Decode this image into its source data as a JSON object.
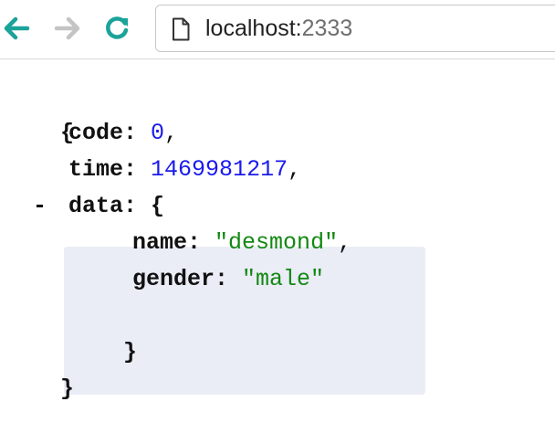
{
  "browser": {
    "url_host": "localhost:",
    "url_port": "2333",
    "icons": {
      "back": "arrow-left-icon",
      "forward": "arrow-right-icon",
      "reload": "reload-icon",
      "page": "page-icon"
    },
    "colors": {
      "accent": "#1ba39a",
      "disabled": "#c4c4c4"
    }
  },
  "json": {
    "open_brace": "{",
    "close_brace": "}",
    "code": {
      "key": "code",
      "colon": ":",
      "value": "0",
      "comma": ","
    },
    "time": {
      "key": "time",
      "colon": ":",
      "value": "1469981217",
      "comma": ","
    },
    "data": {
      "toggle": "-",
      "key": "data",
      "colon": ":",
      "open_brace": "{",
      "close_brace": "}",
      "name": {
        "key": "name",
        "colon": ":",
        "value": "\"desmond\"",
        "comma": ","
      },
      "gender": {
        "key": "gender",
        "colon": ":",
        "value": "\"male\""
      }
    },
    "colors": {
      "number": "#1a1aee",
      "string": "#118811",
      "highlight": "#eaecf6"
    }
  }
}
